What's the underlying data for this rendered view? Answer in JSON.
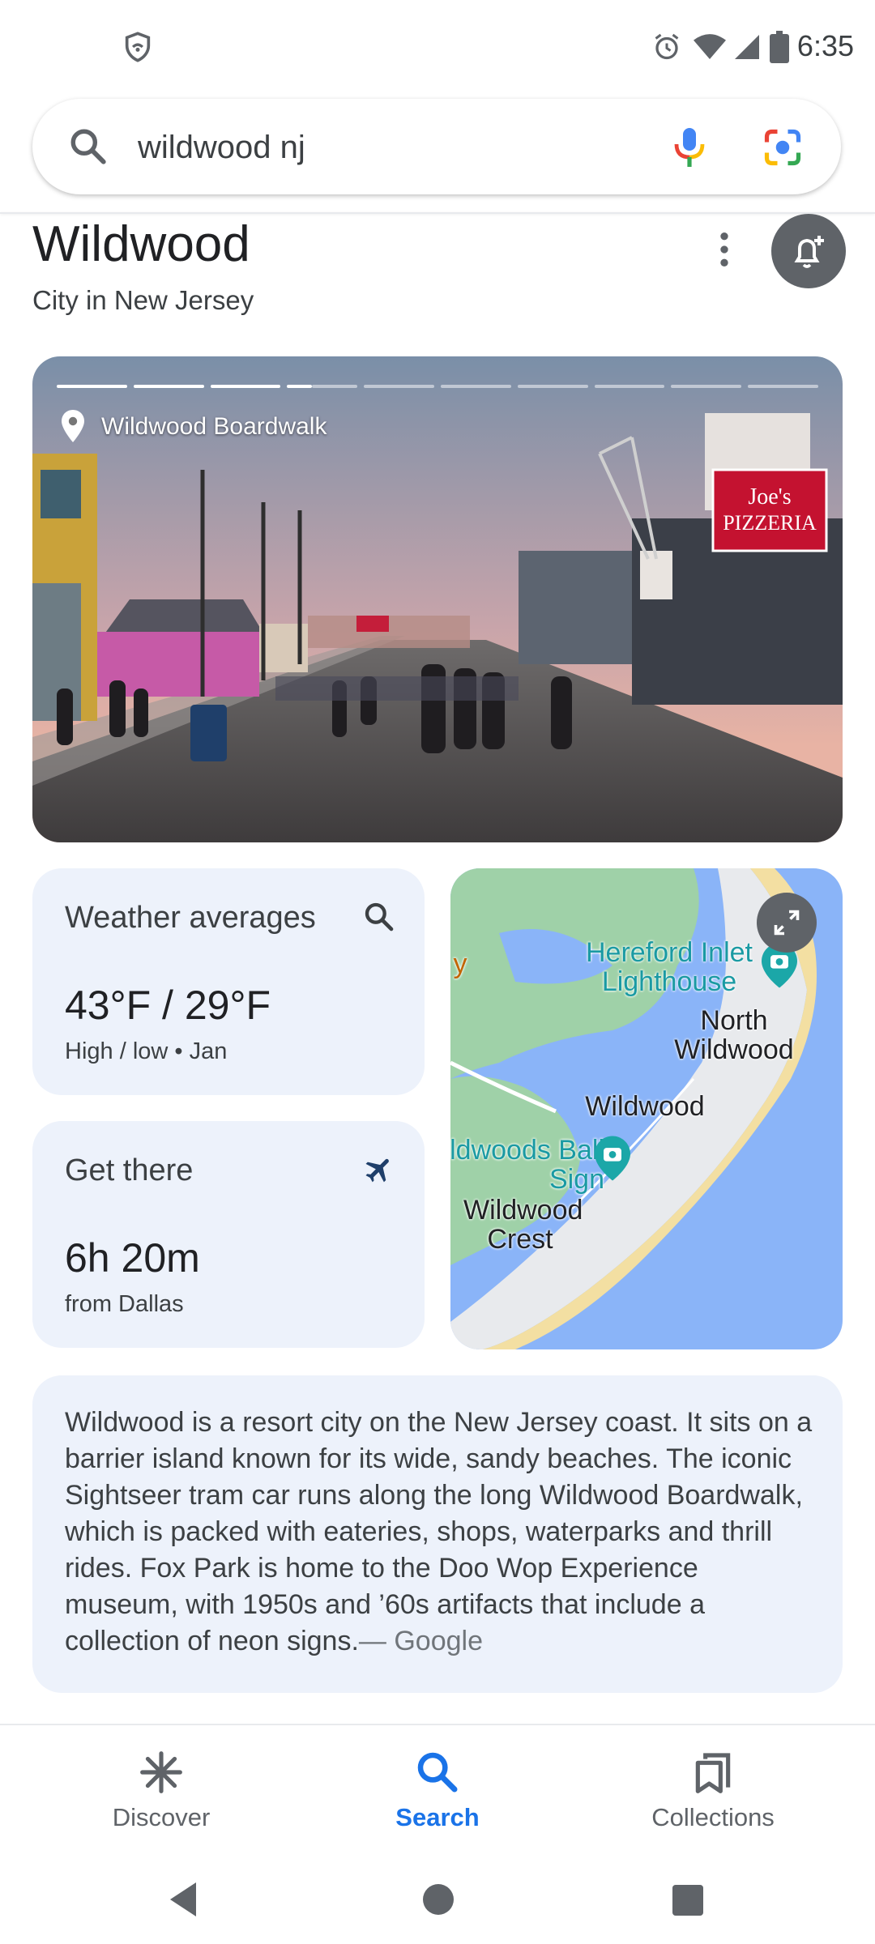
{
  "status_bar": {
    "time": "6:35"
  },
  "search": {
    "query": "wildwood nj"
  },
  "entity": {
    "title": "Wildwood",
    "subtitle": "City in New Jersey"
  },
  "hero": {
    "location_label": "Wildwood Boardwalk",
    "total_segments": 10,
    "current_segment": 4
  },
  "weather_card": {
    "heading": "Weather averages",
    "value": "43°F / 29°F",
    "caption": "High / low • Jan"
  },
  "getthere_card": {
    "heading": "Get there",
    "value": "6h 20m",
    "caption": "from Dallas"
  },
  "map": {
    "labels": {
      "hereford": "Hereford Inlet Lighthouse",
      "north_wildwood": "North Wildwood",
      "wildwood": "Wildwood",
      "ball_sign": "Wildwoods Ball Sign",
      "crest": "Wildwood Crest",
      "y_edge": "y"
    }
  },
  "description": {
    "text": "Wildwood is a resort city on the New Jersey coast. It sits on a barrier island known for its wide, sandy beaches. The iconic Sightseer tram car runs along the long Wildwood Boardwalk, which is packed with eateries, shops, waterparks and thrill rides. Fox Park is home to the Doo Wop Experience museum, with 1950s and ’60s artifacts that include a collection of neon signs.",
    "source": "— Google"
  },
  "bottom_nav": {
    "discover": "Discover",
    "search": "Search",
    "collections": "Collections"
  },
  "colors": {
    "accent": "#1a73e8",
    "card_bg": "#edf2fb",
    "icon_gray": "#5f6368"
  },
  "icons": [
    "vpn-shield-icon",
    "alarm-icon",
    "wifi-icon",
    "signal-icon",
    "battery-icon",
    "search-icon",
    "mic-icon",
    "lens-icon",
    "more-vert-icon",
    "add-alert-icon",
    "location-pin-icon",
    "search-icon",
    "airplane-icon",
    "expand-icon",
    "discover-icon",
    "collections-icon",
    "back-icon",
    "home-icon",
    "recents-icon"
  ]
}
